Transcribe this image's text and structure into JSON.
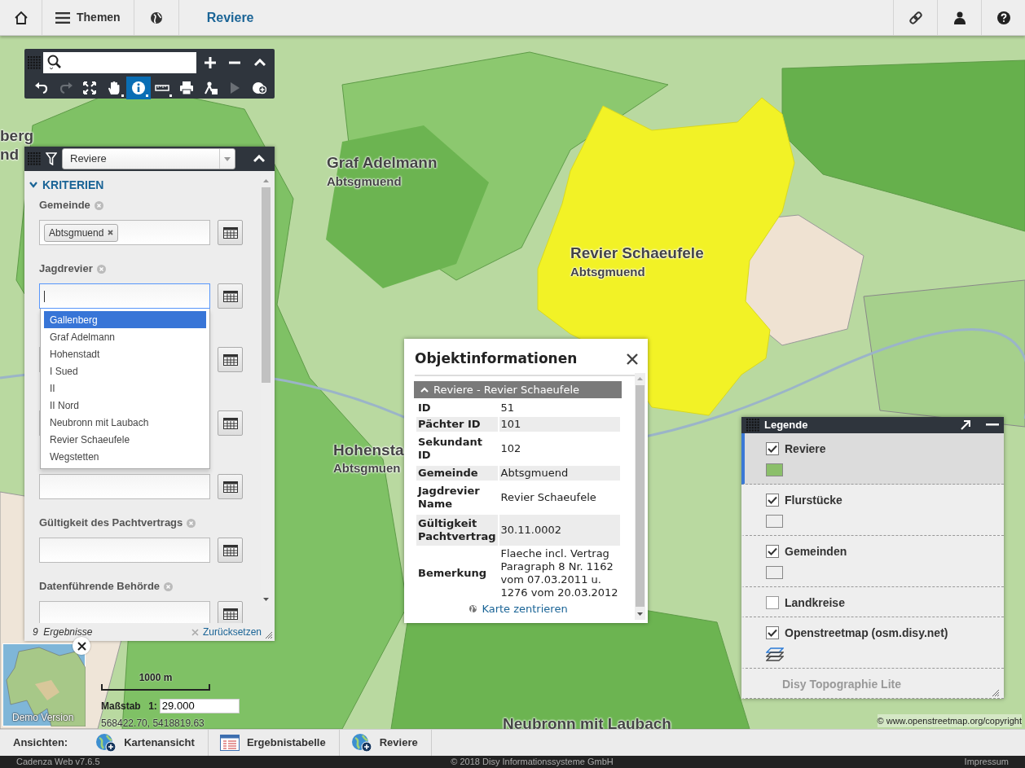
{
  "header": {
    "themes_label": "Themen",
    "title": "Reviere"
  },
  "map_labels": [
    {
      "text": "berg",
      "kind": "name"
    },
    {
      "text": "nd",
      "kind": "name"
    },
    {
      "text": "Graf Adelmann",
      "kind": "name"
    },
    {
      "text": "Abtsgmuend",
      "kind": "place"
    },
    {
      "text": "Revier Schaeufele",
      "kind": "name"
    },
    {
      "text": "Abtsgmuend",
      "kind": "place"
    },
    {
      "text": "Hohensta",
      "kind": "name"
    },
    {
      "text": "Abtsgmuen",
      "kind": "place"
    },
    {
      "text": "Neubronn mit Laubach",
      "kind": "name"
    }
  ],
  "map_copyright": "© www.openstreetmap.org/copyright",
  "toolbar": {
    "tools": [
      {
        "selected": false,
        "disabled": false,
        "menu": false
      },
      {
        "selected": false,
        "disabled": true,
        "menu": false
      },
      {
        "selected": false,
        "disabled": false,
        "menu": false
      },
      {
        "selected": false,
        "disabled": false,
        "menu": true
      },
      {
        "selected": true,
        "disabled": false,
        "menu": true
      },
      {
        "selected": false,
        "disabled": false,
        "menu": true
      },
      {
        "selected": false,
        "disabled": false,
        "menu": false
      },
      {
        "selected": false,
        "disabled": false,
        "menu": false
      },
      {
        "selected": false,
        "disabled": true,
        "menu": false
      },
      {
        "selected": false,
        "disabled": false,
        "menu": false
      }
    ]
  },
  "filter_panel": {
    "layer": "Reviere",
    "section": "KRITERIEN",
    "expanded": true,
    "fields": [
      {
        "label": "Gemeinde",
        "tags": [
          "Abtsgmuend"
        ],
        "focused": false
      },
      {
        "label": "Jagdrevier",
        "focused": true,
        "options": [
          {
            "label": "Gallenberg",
            "selected": true
          },
          {
            "label": "Graf Adelmann",
            "selected": false
          },
          {
            "label": "Hohenstadt",
            "selected": false
          },
          {
            "label": "I Sued",
            "selected": false
          },
          {
            "label": "II",
            "selected": false
          },
          {
            "label": "II Nord",
            "selected": false
          },
          {
            "label": "Neubronn mit Laubach",
            "selected": false
          },
          {
            "label": "Revier Schaeufele",
            "selected": false
          },
          {
            "label": "Wegstetten",
            "selected": false
          }
        ]
      },
      {
        "focused": false
      },
      {
        "focused": false
      },
      {
        "focused": false
      },
      {
        "label": "Gültigkeit des Pachtvertrags",
        "focused": false
      },
      {
        "label": "Datenführende Behörde",
        "focused": false
      }
    ],
    "result_count": "9",
    "result_label": "Ergebnisse",
    "reset": "Zurücksetzen"
  },
  "popup": {
    "title": "Objektinformationen",
    "group": "Reviere - Revier Schaeufele",
    "expanded": true,
    "rows": [
      {
        "key": "ID",
        "value": "51"
      },
      {
        "key": "Pächter ID",
        "value": "101"
      },
      {
        "key": "Sekundant ID",
        "value": "102"
      },
      {
        "key": "Gemeinde",
        "value": "Abtsgmuend"
      },
      {
        "key": "Jagdrevier Name",
        "value": "Revier Schaeufele"
      },
      {
        "key": "Gültigkeit Pachtvertrag",
        "value": "30.11.0002"
      },
      {
        "key": "Bemerkung",
        "value": "Flaeche incl. Vertrag Paragraph 8 Nr. 1162 vom 07.03.2011 u. 1276 vom 20.03.2012"
      }
    ],
    "link": "Karte zentrieren"
  },
  "legend": {
    "title": "Legende",
    "items": [
      {
        "label": "Reviere",
        "checked": true,
        "selected": true,
        "disabled": false,
        "kind": "fill",
        "color": "#8bbf6a"
      },
      {
        "label": "Flurstücke",
        "checked": true,
        "selected": false,
        "disabled": false,
        "kind": "outline"
      },
      {
        "label": "Gemeinden",
        "checked": true,
        "selected": false,
        "disabled": false,
        "kind": "outline"
      },
      {
        "label": "Landkreise",
        "checked": false,
        "selected": false,
        "disabled": false,
        "kind": "plain"
      },
      {
        "label": "Openstreetmap (osm.disy.net)",
        "checked": true,
        "selected": false,
        "disabled": false,
        "kind": "layers"
      },
      {
        "label": "Disy Topographie Lite",
        "checked": false,
        "selected": false,
        "disabled": true,
        "kind": "plain"
      }
    ]
  },
  "overview": {
    "watermark": "Demo Version"
  },
  "scale": {
    "bar": "1000 m",
    "label": "Maßstab",
    "prefix": "1:",
    "value": "29.000",
    "coordinates": "568422.70, 5418819.63"
  },
  "views": {
    "label": "Ansichten:",
    "tabs": [
      {
        "label": "Kartenansicht",
        "kind": "map"
      },
      {
        "label": "Ergebnistabelle",
        "kind": "table"
      },
      {
        "label": "Reviere",
        "kind": "map"
      }
    ]
  },
  "footer": {
    "version": "Cadenza Web v7.6.5",
    "copyright": "© 2018 Disy Informationssysteme GmbH",
    "link": "Impressum"
  }
}
